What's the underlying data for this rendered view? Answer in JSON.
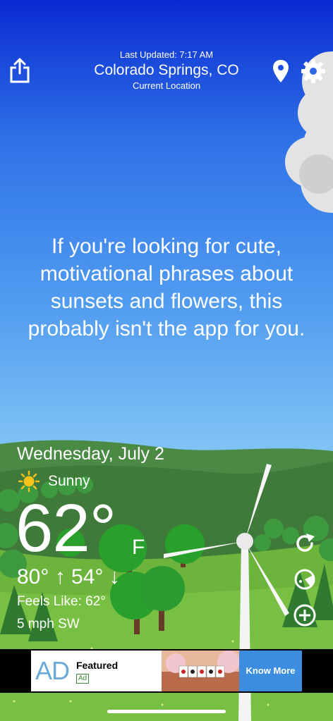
{
  "header": {
    "last_updated": "Last Updated: 7:17 AM",
    "city": "Colorado Springs, CO",
    "location_label": "Current Location",
    "icons": {
      "share": "share-icon",
      "location": "location-pin-icon",
      "settings": "gear-icon"
    }
  },
  "quote": "If you're looking for cute, motivational phrases about sunsets and flowers, this probably isn't the app for you.",
  "weather": {
    "date": "Wednesday, July 2",
    "condition": "Sunny",
    "condition_icon": "sun-icon",
    "temperature": "62°",
    "unit": "F",
    "hi_lo": "80° ↑ 54° ↓",
    "feels_like": "Feels Like: 62°",
    "wind": "5 mph SW"
  },
  "side_actions": {
    "icons": [
      "refresh-icon",
      "radar-icon",
      "add-icon"
    ]
  },
  "ad": {
    "logo": "AD",
    "title": "Featured",
    "badge": "Ad",
    "cta": "Know More"
  },
  "colors": {
    "sky_top": "#0a2ad1",
    "sky_bottom": "#8ccaf2",
    "hill_dark": "#3f7a3a",
    "grass": "#6cb43c",
    "sun": "#f7c21a",
    "ad_cta": "#3c8de0"
  }
}
